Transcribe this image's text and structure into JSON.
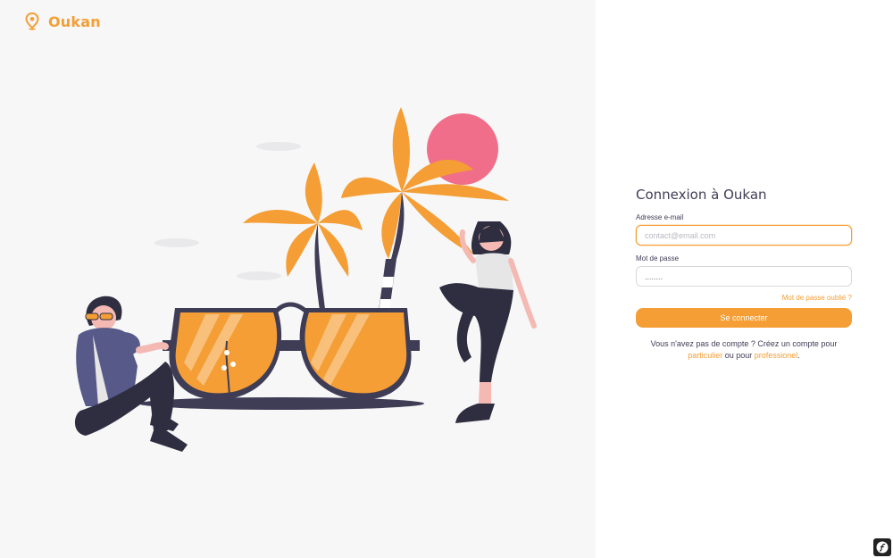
{
  "brand": {
    "name": "Oukan",
    "icon": "map-pin-icon",
    "color": "#f49e35"
  },
  "login": {
    "title": "Connexion à Oukan",
    "email_label": "Adresse e-mail",
    "email_placeholder": "contact@email.com",
    "password_label": "Mot de passe",
    "password_value": "........",
    "forgot_link": "Mot de passe oublié ?",
    "submit_label": "Se connecter",
    "signup_text_1": "Vous n'avez pas de compte ? Créez un compte pour",
    "signup_link_particulier": "particulier",
    "signup_text_2": "ou pour",
    "signup_link_pro": "professionel",
    "signup_text_3": "."
  },
  "colors": {
    "accent": "#f49e35",
    "dark": "#3f3d56",
    "sun": "#f06e8a",
    "left_bg": "#f7f7f7"
  },
  "debug_toolbar": {
    "icon": "symfony-logo-icon"
  }
}
